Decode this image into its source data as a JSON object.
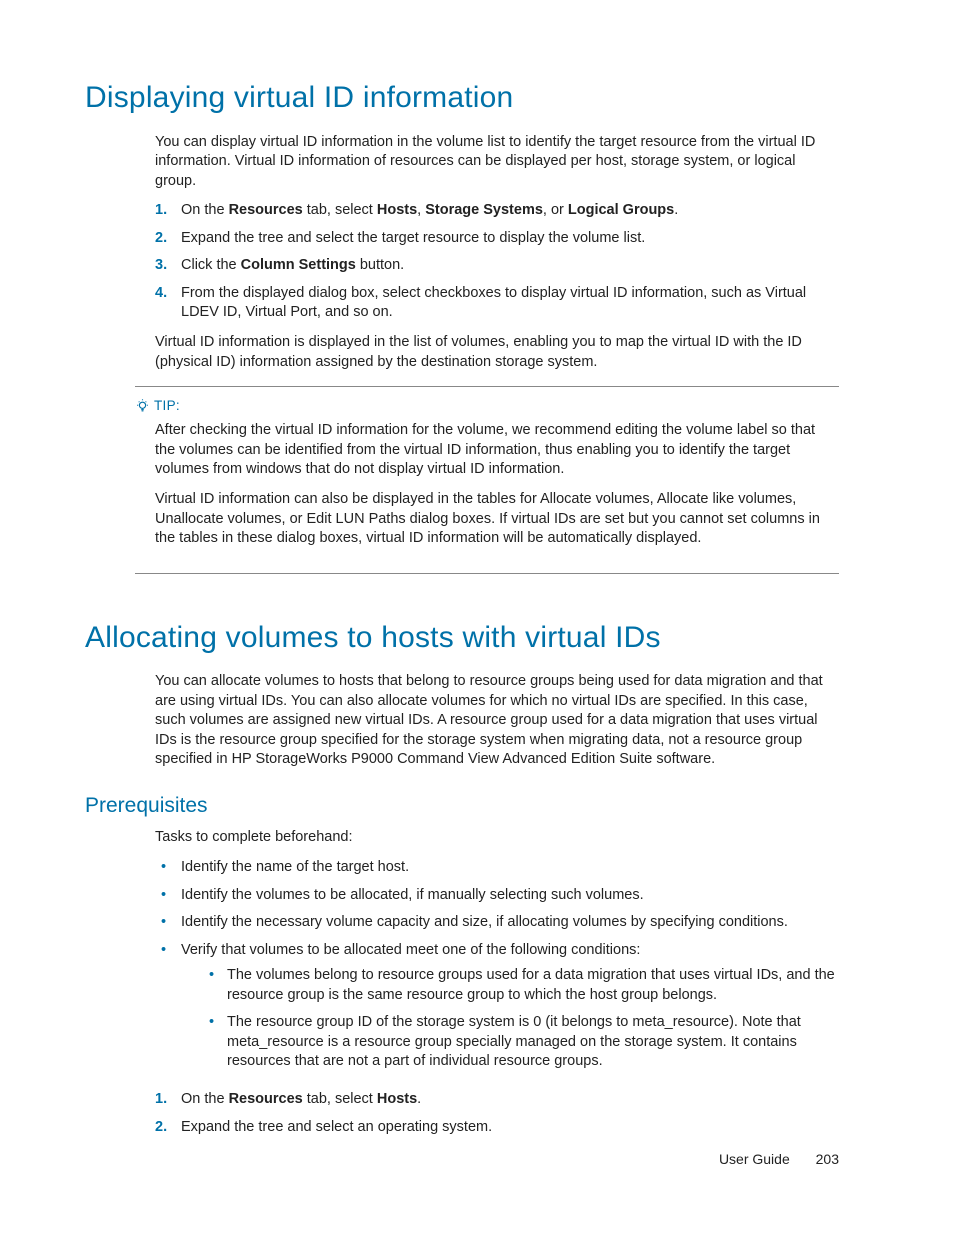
{
  "section1": {
    "title": "Displaying virtual ID information",
    "intro": "You can display virtual ID information in the volume list to identify the target resource from the virtual ID information. Virtual ID information of resources can be displayed per host, storage system, or logical group.",
    "steps": {
      "s1_a": "On the ",
      "s1_b": "Resources",
      "s1_c": " tab, select ",
      "s1_d": "Hosts",
      "s1_e": ", ",
      "s1_f": "Storage Systems",
      "s1_g": ", or ",
      "s1_h": "Logical Groups",
      "s1_i": ".",
      "s2": "Expand the tree and select the target resource to display the volume list.",
      "s3_a": "Click the ",
      "s3_b": "Column Settings",
      "s3_c": " button.",
      "s4": "From the displayed dialog box, select checkboxes to display virtual ID information, such as Virtual LDEV ID, Virtual Port, and so on."
    },
    "after": "Virtual ID information is displayed in the list of volumes, enabling you to map the virtual ID with the ID (physical ID) information assigned by the destination storage system.",
    "tip": {
      "label": "TIP:",
      "p1": "After checking the virtual ID information for the volume, we recommend editing the volume label so that the volumes can be identified from the virtual ID information, thus enabling you to identify the target volumes from windows that do not display virtual ID information.",
      "p2": "Virtual ID information can also be displayed in the tables for Allocate volumes, Allocate like volumes, Unallocate volumes, or Edit LUN Paths dialog boxes. If virtual IDs are set but you cannot set columns in the tables in these dialog boxes, virtual ID information will be automatically displayed."
    }
  },
  "section2": {
    "title": "Allocating volumes to hosts with virtual IDs",
    "intro": "You can allocate volumes to hosts that belong to resource groups being used for data migration and that are using virtual IDs. You can also allocate volumes for which no virtual IDs are specified. In this case, such volumes are assigned new virtual IDs. A resource group used for a data migration that uses virtual IDs is the resource group specified for the storage system when migrating data, not a resource group specified in HP StorageWorks P9000 Command View Advanced Edition Suite software.",
    "prereq": {
      "title": "Prerequisites",
      "lead": "Tasks to complete beforehand:",
      "b1": "Identify the name of the target host.",
      "b2": "Identify the volumes to be allocated, if manually selecting such volumes.",
      "b3": "Identify the necessary volume capacity and size, if allocating volumes by specifying conditions.",
      "b4": "Verify that volumes to be allocated meet one of the following conditions:",
      "b4a": "The volumes belong to resource groups used for a data migration that uses virtual IDs, and the resource group is the same resource group to which the host group belongs.",
      "b4b": "The resource group ID of the storage system is 0 (it belongs to meta_resource). Note that meta_resource is a resource group specially managed on the storage system. It contains resources that are not a part of individual resource groups."
    },
    "steps": {
      "s1_a": "On the ",
      "s1_b": "Resources",
      "s1_c": " tab, select ",
      "s1_d": "Hosts",
      "s1_e": ".",
      "s2": "Expand the tree and select an operating system."
    }
  },
  "footer": {
    "label": "User Guide",
    "page": "203"
  },
  "nums": {
    "n1": "1.",
    "n2": "2.",
    "n3": "3.",
    "n4": "4."
  }
}
